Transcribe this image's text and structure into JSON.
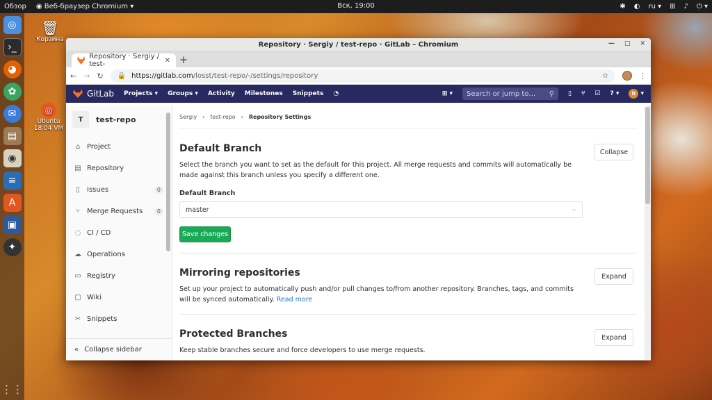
{
  "desktop": {
    "activities": "Обзор",
    "app_menu": "Веб-браузер Chromium",
    "clock": "Вск, 19:00",
    "lang": "ru",
    "trash_label": "Корзина",
    "ubuntu_label": "Ubuntu 18.04 VM"
  },
  "window": {
    "title": "Repository · Sergiy / test-repo · GitLab – Chromium",
    "tab_title": "Repository · Sergiy / test-",
    "url_host": "https://gitlab.com",
    "url_path": "/losst/test-repo/-/settings/repository"
  },
  "gitlab_nav": {
    "brand": "GitLab",
    "projects": "Projects",
    "groups": "Groups",
    "activity": "Activity",
    "milestones": "Milestones",
    "snippets": "Snippets",
    "search_placeholder": "Search or jump to…"
  },
  "sidebar": {
    "project_initial": "T",
    "project_name": "test-repo",
    "items": [
      {
        "label": "Project",
        "icon": "home-icon"
      },
      {
        "label": "Repository",
        "icon": "doc-icon"
      },
      {
        "label": "Issues",
        "icon": "issues-icon",
        "count": "0"
      },
      {
        "label": "Merge Requests",
        "icon": "merge-icon",
        "count": "0"
      },
      {
        "label": "CI / CD",
        "icon": "rocket-icon"
      },
      {
        "label": "Operations",
        "icon": "cloud-icon"
      },
      {
        "label": "Registry",
        "icon": "box-icon"
      },
      {
        "label": "Wiki",
        "icon": "book-icon"
      },
      {
        "label": "Snippets",
        "icon": "scissors-icon"
      }
    ],
    "collapse": "Collapse sidebar"
  },
  "breadcrumb": {
    "user": "Sergiy",
    "repo": "test-repo",
    "current": "Repository Settings"
  },
  "default_branch": {
    "title": "Default Branch",
    "desc": "Select the branch you want to set as the default for this project. All merge requests and commits will automatically be made against this branch unless you specify a different one.",
    "toggle": "Collapse",
    "field_label": "Default Branch",
    "value": "master",
    "save": "Save changes"
  },
  "mirroring": {
    "title": "Mirroring repositories",
    "desc": "Set up your project to automatically push and/or pull changes to/from another repository. Branches, tags, and commits will be synced automatically.",
    "read_more": "Read more",
    "toggle": "Expand"
  },
  "protected": {
    "title": "Protected Branches",
    "desc": "Keep stable branches secure and force developers to use merge requests.",
    "toggle": "Expand"
  }
}
